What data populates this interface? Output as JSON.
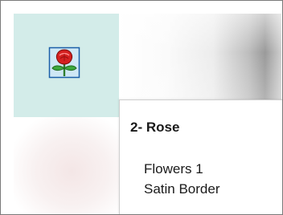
{
  "tile": {
    "icon": "rose-icon",
    "background": "#d3ece9"
  },
  "tooltip": {
    "title": "2- Rose",
    "lines": [
      "Flowers 1",
      "Satin Border"
    ]
  }
}
